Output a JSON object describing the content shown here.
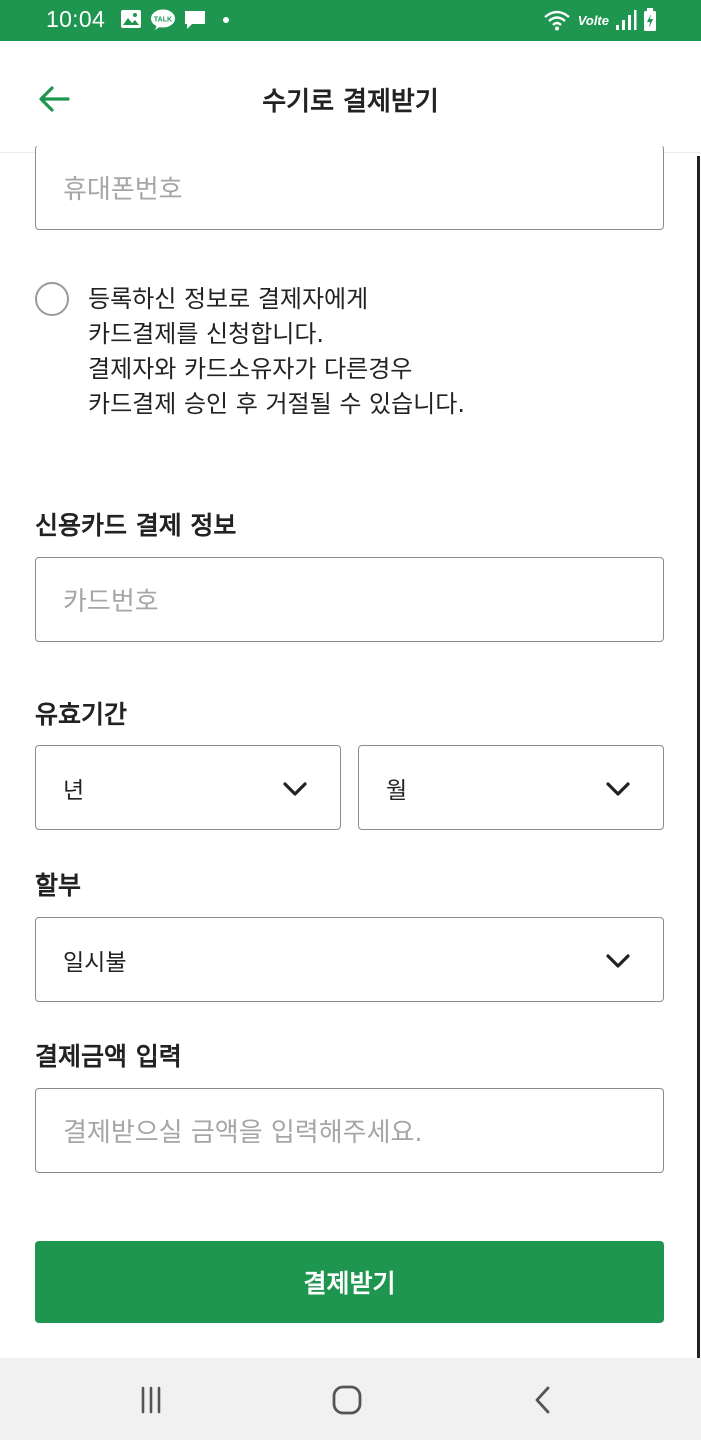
{
  "status_bar": {
    "time": "10:04",
    "network_label": "Volte",
    "bg_color": "#1e9650",
    "icons": [
      "gallery-icon",
      "talk-icon",
      "chat-icon",
      "dot-icon",
      "wifi-icon",
      "signal-icon",
      "battery-icon"
    ]
  },
  "header": {
    "title": "수기로 결제받기",
    "back_icon": "arrow-left-icon"
  },
  "form": {
    "phone_placeholder": "휴대폰번호",
    "consent_lines": [
      "등록하신 정보로 결제자에게",
      "카드결제를 신청합니다.",
      "결제자와 카드소유자가 다른경우",
      "카드결제 승인 후 거절될 수 있습니다."
    ],
    "consent_checked": false,
    "card_section_label": "신용카드 결제 정보",
    "card_number_placeholder": "카드번호",
    "expiry_label": "유효기간",
    "expiry_year": "년",
    "expiry_month": "월",
    "installment_label": "할부",
    "installment_value": "일시불",
    "amount_label": "결제금액 입력",
    "amount_placeholder": "결제받으실 금액을 입력해주세요."
  },
  "submit_label": "결제받기",
  "accent_color": "#1e9650",
  "nav_bar": {
    "icons": [
      "recent-apps-icon",
      "home-icon",
      "back-icon"
    ]
  }
}
